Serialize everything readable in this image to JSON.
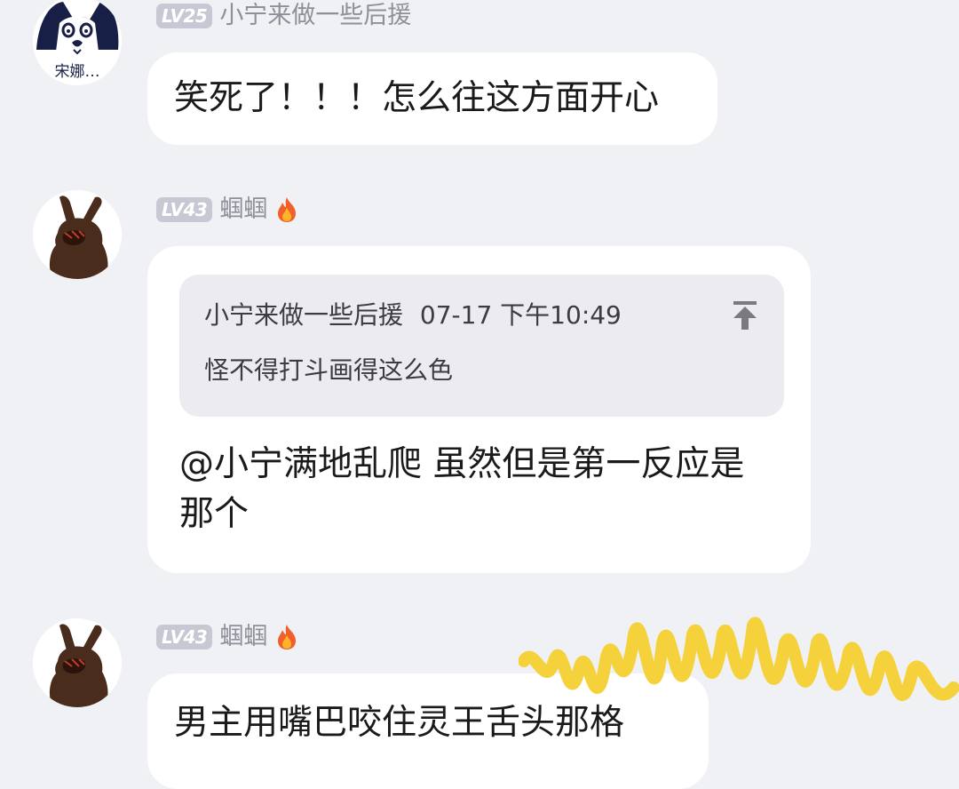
{
  "messages": [
    {
      "id": "m1",
      "level": "LV25",
      "nickname": "小宁来做一些后援",
      "avatar_icon": "cartoon-rabbit-face-icon",
      "avatar_caption": "宋娜…",
      "has_flame": false,
      "text": "笑死了！！！怎么往这方面开心"
    },
    {
      "id": "m2",
      "level": "LV43",
      "nickname": "蝈蝈",
      "avatar_icon": "brown-rabbit-icon",
      "has_flame": true,
      "flame_icon": "flame-icon",
      "quote": {
        "author": "小宁来做一些后援",
        "time": "07-17 下午10:49",
        "text": "怪不得打斗画得这么色",
        "jump_icon": "arrow-to-top-icon"
      },
      "text": "@小宁满地乱爬 虽然但是第一反应是那个"
    },
    {
      "id": "m3",
      "level": "LV43",
      "nickname": "蝈蝈",
      "avatar_icon": "brown-rabbit-icon",
      "has_flame": true,
      "flame_icon": "flame-icon",
      "text": "男主用嘴巴咬住灵王舌头那格"
    }
  ],
  "colors": {
    "background": "#f0f1f5",
    "bubble": "#ffffff",
    "quote_background": "#ececf0",
    "level_badge": "#c6c9d3",
    "nickname": "#8e9099",
    "scribble": "#f5d23c"
  }
}
